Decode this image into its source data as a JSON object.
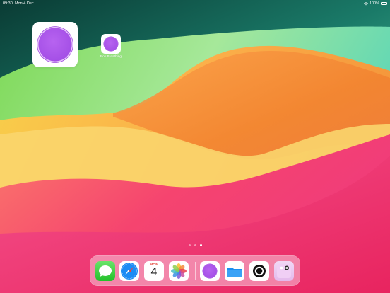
{
  "status_bar": {
    "time": "09:30",
    "date": "Mon 4 Dec",
    "battery": "100%"
  },
  "home": {
    "widget_icon": "breathing-circle",
    "app": {
      "label": "Box Breathing",
      "icon": "breathing-circle-icon"
    },
    "page_dots": {
      "count": 3,
      "active_index": 2
    }
  },
  "dock": {
    "apps": [
      {
        "name": "Messages",
        "icon": "messages-icon"
      },
      {
        "name": "Safari",
        "icon": "safari-icon"
      },
      {
        "name": "Calendar",
        "icon": "calendar-icon",
        "month": "MON",
        "day": "4"
      },
      {
        "name": "Photos",
        "icon": "photos-icon"
      }
    ],
    "recent_apps": [
      {
        "name": "Box Breathing",
        "icon": "breathing-circle-icon"
      },
      {
        "name": "Files",
        "icon": "folder-icon"
      },
      {
        "name": "Camera app",
        "icon": "ring-icon"
      },
      {
        "name": "Camera app 2",
        "icon": "camera-icon"
      }
    ]
  },
  "colors": {
    "accent_purple": "#a44fe6",
    "calendar_red": "#e23b30",
    "messages_green": "#2dc83a",
    "files_blue": "#1b8ff0"
  }
}
